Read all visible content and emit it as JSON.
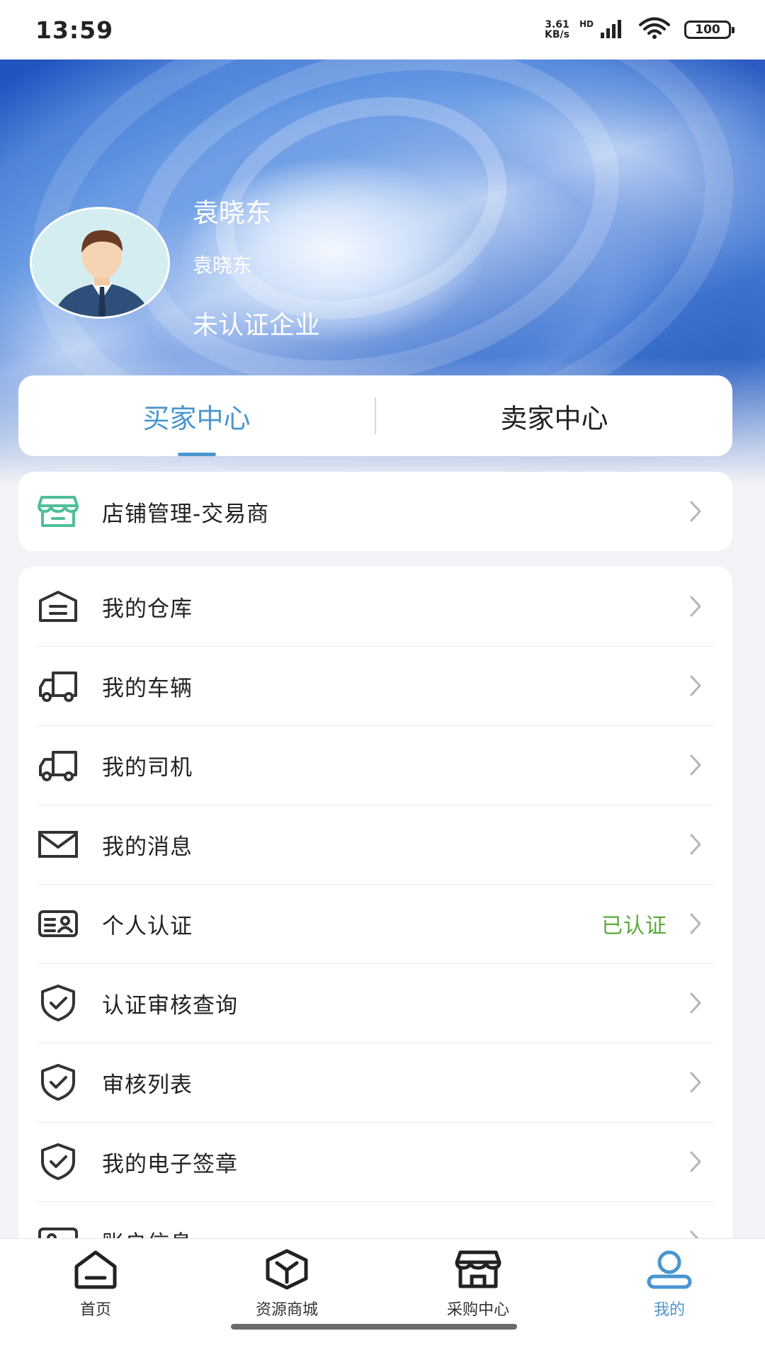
{
  "status_bar": {
    "time": "13:59",
    "net_speed_value": "3.61",
    "net_speed_unit": "KB/s",
    "signal_label": "HD",
    "battery": "100"
  },
  "profile": {
    "name": "袁晓东",
    "sub_name": "袁晓东",
    "status": "未认证企业"
  },
  "center_tabs": [
    {
      "label": "买家中心",
      "active": true
    },
    {
      "label": "卖家中心",
      "active": false
    }
  ],
  "store": {
    "label": "店铺管理-交易商",
    "icon": "store-icon",
    "icon_color": "#4fbf96"
  },
  "menu": [
    {
      "label": "我的仓库",
      "icon": "warehouse-icon"
    },
    {
      "label": "我的车辆",
      "icon": "truck-icon"
    },
    {
      "label": "我的司机",
      "icon": "truck-icon"
    },
    {
      "label": "我的消息",
      "icon": "mail-icon"
    },
    {
      "label": "个人认证",
      "icon": "id-card-icon",
      "value": "已认证",
      "value_color": "#5ba93a"
    },
    {
      "label": "认证审核查询",
      "icon": "shield-check-icon"
    },
    {
      "label": "审核列表",
      "icon": "shield-check-icon"
    },
    {
      "label": "我的电子签章",
      "icon": "shield-check-icon"
    },
    {
      "label": "账户信息",
      "icon": "id-card-icon"
    }
  ],
  "bottom_nav": [
    {
      "label": "首页",
      "icon": "home-icon",
      "active": false
    },
    {
      "label": "资源商城",
      "icon": "box-icon",
      "active": false
    },
    {
      "label": "采购中心",
      "icon": "shop-icon",
      "active": false
    },
    {
      "label": "我的",
      "icon": "user-icon",
      "active": true
    }
  ],
  "colors": {
    "accent": "#4a96cf",
    "verified": "#5ba93a",
    "store_icon": "#4fbf96"
  }
}
